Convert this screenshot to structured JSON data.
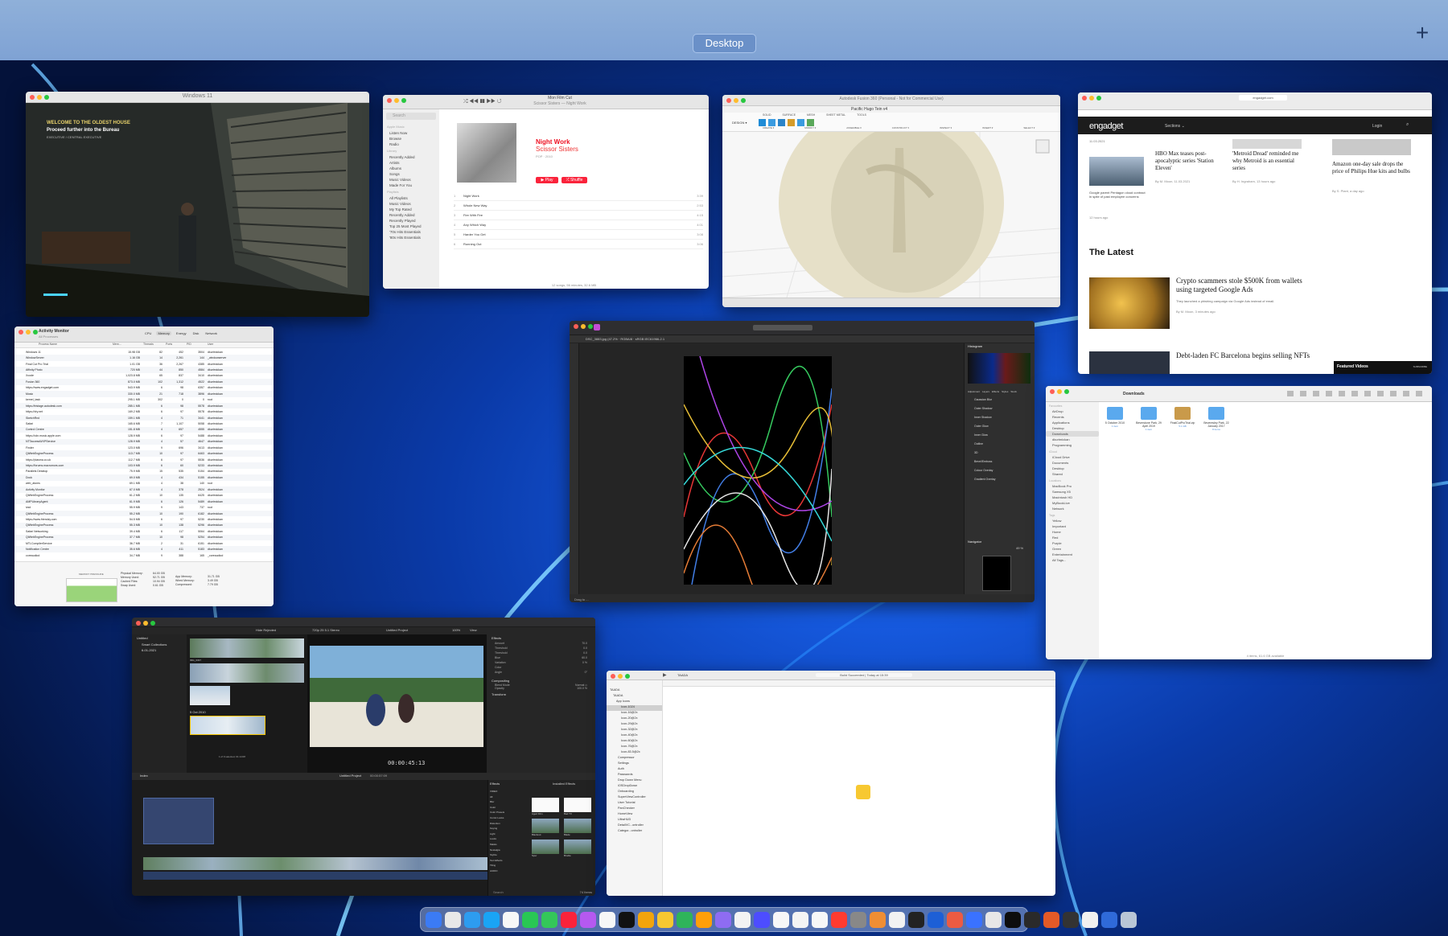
{
  "mission_control": {
    "space_label": "Desktop",
    "add_space_symbol": "+"
  },
  "windows": {
    "game": {
      "title": "Windows 11",
      "hud_line1": "WELCOME TO THE OLDEST HOUSE",
      "hud_line2": "Proceed further into the Bureau",
      "hud_line3": "EXECUTIVE / CENTRAL EXECUTIVE"
    },
    "music": {
      "now_playing_title": "Mon Film Cut",
      "now_playing_sub": "Scissor Sisters — Night Work",
      "search_placeholder": "Search",
      "sidebar_heading_apple": "Apple Music",
      "sidebar_items": [
        "Listen Now",
        "Browse",
        "Radio"
      ],
      "sidebar_heading_library": "Library",
      "library_items": [
        "Recently Added",
        "Artists",
        "Albums",
        "Songs",
        "Music Videos",
        "Made For You"
      ],
      "sidebar_heading_playlists": "Playlists",
      "playlist_items": [
        "All Playlists",
        "Music Videos",
        "My Top Rated",
        "Recently Added",
        "Recently Played",
        "Top 25 Most Played",
        "'70s Hits Essentials",
        "'80s Hits Essentials"
      ],
      "album_title": "Night Work",
      "album_artist": "Scissor Sisters",
      "album_meta": "POP · 2010",
      "play_label": "▶ Play",
      "shuffle_label": "⤮ Shuffle",
      "tracks": [
        {
          "n": "1",
          "name": "Night Work",
          "time": "3:39"
        },
        {
          "n": "2",
          "name": "Whole New Way",
          "time": "2:53"
        },
        {
          "n": "3",
          "name": "Fire With Fire",
          "time": "4:15"
        },
        {
          "n": "4",
          "name": "Any Which Way",
          "time": "4:01"
        },
        {
          "n": "5",
          "name": "Harder You Get",
          "time": "3:08"
        },
        {
          "n": "6",
          "name": "Running Out",
          "time": "3:06"
        }
      ],
      "footer": "12 songs, 56 minutes, 32.6 MB"
    },
    "fusion": {
      "title": "Autodesk Fusion 360 (Personal - Not for Commercial Use)",
      "tab_title": "Pacific Hugo Tein v4",
      "toolbar_tabs": [
        "SOLID",
        "SURFACE",
        "MESH",
        "SHEET METAL",
        "TOOLS"
      ],
      "design_label": "DESIGN ▾",
      "toolbar_groups": [
        "CREATE ▾",
        "MODIFY ▾",
        "ASSEMBLE ▾",
        "CONSTRUCT ▾",
        "INSPECT ▾",
        "INSERT ▾",
        "SELECT ▾"
      ]
    },
    "engadget": {
      "url": "engadget.com",
      "logo": "engadget",
      "nav_sections": "Sections ⌄",
      "nav_login": "Login",
      "date_left": "11.03.2021",
      "left_blurb": "Google parent Pentagon cloud contract in spite of past employee concerns",
      "left_time": "12 hours ago",
      "headline1": "HBO Max teases post-apocalyptic series 'Station Eleven'",
      "byline1": "By M. Moon, 11.03.2021",
      "headline2": "'Metroid Dread' reminded me why Metroid is an essential series",
      "byline2": "By H. Ingraham, 13 hours ago",
      "headline3": "Amazon one-day sale drops the price of Philips Hue kits and bulbs",
      "byline3": "By S. Plant, a day ago",
      "latest_heading": "The Latest",
      "latest1_title": "Crypto scammers stole $500K from wallets using targeted Google Ads",
      "latest1_blurb": "They launched a phishing campaign via Google Ads instead of email.",
      "latest1_byline": "By M. Moon, 3 minutes ago",
      "latest2_title": "Debt-laden FC Barcelona begins selling NFTs",
      "featured_label": "Featured Videos",
      "subscribe_label": "SUBSCRIBE"
    },
    "activity": {
      "title": "Activity Monitor",
      "subtitle": "All Processes",
      "tabs": [
        "CPU",
        "Memory",
        "Energy",
        "Disk",
        "Network"
      ],
      "columns": [
        "Process Name",
        "Mem...",
        "Threads",
        "Ports",
        "PID",
        "User"
      ],
      "rows": [
        [
          "Windows 11",
          "15.98 GB",
          "82",
          "452",
          "3504",
          "dkurtmickan"
        ],
        [
          "WindowServer",
          "1.16 GB",
          "14",
          "2,261",
          "144",
          "_windowserver"
        ],
        [
          "Final Cut Pro Trial",
          "1.01 GB",
          "36",
          "2,267",
          "4385",
          "dkurtmickan"
        ],
        [
          "Affinity Photo",
          "720 MB",
          "44",
          "850",
          "4584",
          "dkurtmickan"
        ],
        [
          "Xcode",
          "1,023.8 MB",
          "65",
          "837",
          "3410",
          "dkurtmickan"
        ],
        [
          "Fusion 360",
          "873.0 MB",
          "102",
          "1,312",
          "4522",
          "dkurtmickan"
        ],
        [
          "https://www.engadget.com",
          "543.9 MB",
          "6",
          "98",
          "6357",
          "dkurtmickan"
        ],
        [
          "Music",
          "330.0 MB",
          "21",
          "718",
          "3896",
          "dkurtmickan"
        ],
        [
          "kernel_task",
          "295.1 MB",
          "302",
          "0",
          "0",
          "root"
        ],
        [
          "https://tristage.autodesk.com",
          "285.1 MB",
          "6",
          "98",
          "5578",
          "dkurtmickan"
        ],
        [
          "https://dry.net",
          "169.2 MB",
          "6",
          "97",
          "5578",
          "dkurtmickan"
        ],
        [
          "SketchRnd",
          "159.1 MB",
          "4",
          "71",
          "3441",
          "dkurtmickan"
        ],
        [
          "Safari",
          "165.6 MB",
          "7",
          "1,107",
          "5058",
          "dkurtmickan"
        ],
        [
          "Control Centre",
          "151.8 MB",
          "4",
          "657",
          "4555",
          "dkurtmickan"
        ],
        [
          "https://cdn.music.apple.com",
          "128.9 MB",
          "6",
          "97",
          "5488",
          "dkurtmickan"
        ],
        [
          "NTTaccessWXPService",
          "128.9 MB",
          "4",
          "57",
          "4647",
          "dkurtmickan"
        ],
        [
          "Finder",
          "123.0 MB",
          "9",
          "696",
          "3413",
          "dkurtmickan"
        ],
        [
          "QtWebEngineProcess",
          "113.7 MB",
          "10",
          "97",
          "6463",
          "dkurtmickan"
        ],
        [
          "https://plasma.co.uk",
          "112.7 MB",
          "6",
          "97",
          "5536",
          "dkurtmickan"
        ],
        [
          "https://forums.macrumors.com",
          "103.9 MB",
          "6",
          "60",
          "5233",
          "dkurtmickan"
        ],
        [
          "Parallels Desktop",
          "75.9 MB",
          "15",
          "535",
          "5154",
          "dkurtmickan"
        ],
        [
          "Dock",
          "69.0 MB",
          "4",
          "434",
          "5155",
          "dkurtmickan"
        ],
        [
          "web_atoms",
          "69.1 MB",
          "4",
          "38",
          "140",
          "root"
        ],
        [
          "Activity Monitor",
          "67.0 MB",
          "4",
          "378",
          "2524",
          "dkurtmickan"
        ],
        [
          "QtWebEngineProcess",
          "61.2 MB",
          "10",
          "135",
          "6425",
          "dkurtmickan"
        ],
        [
          "AMPLibraryAgent",
          "61.9 MB",
          "6",
          "126",
          "5489",
          "dkurtmickan"
        ],
        [
          "ivsd",
          "55.9 MB",
          "9",
          "143",
          "737",
          "root"
        ],
        [
          "QtWebEngineProcess",
          "55.2 MB",
          "10",
          "190",
          "6182",
          "dkurtmickan"
        ],
        [
          "https://www.friendzy.com",
          "54.5 MB",
          "6",
          "97",
          "5230",
          "dkurtmickan"
        ],
        [
          "QtWebEngineProcess",
          "55.3 MB",
          "10",
          "138",
          "5296",
          "dkurtmickan"
        ],
        [
          "Safari Networking",
          "39.4 MB",
          "6",
          "117",
          "5064",
          "dkurtmickan"
        ],
        [
          "QtWebEngineProcess",
          "37.7 MB",
          "10",
          "98",
          "5254",
          "dkurtmickan"
        ],
        [
          "MTLCompilerService",
          "36.7 MB",
          "2",
          "31",
          "6151",
          "dkurtmickan"
        ],
        [
          "Notification Centre",
          "35.6 MB",
          "4",
          "411",
          "5183",
          "dkurtmickan"
        ],
        [
          "coreaudiod",
          "34.7 MB",
          "9",
          "388",
          "165",
          "_coreaudiod"
        ]
      ],
      "pressure_label": "MEMORY PRESSURE",
      "stats_left": [
        [
          "Physical Memory:",
          "64.00 GB"
        ],
        [
          "Memory Used:",
          "52.71 GB"
        ],
        [
          "Cached Files:",
          "10.94 GB"
        ],
        [
          "Swap Used:",
          "0.61 GB"
        ]
      ],
      "stats_right": [
        [
          "App Memory:",
          "31.71 GB"
        ],
        [
          "Wired Memory:",
          "3.49 GB"
        ],
        [
          "Compressed:",
          "7.79 GB"
        ]
      ]
    },
    "affinity": {
      "doc_tab": "DSC_3883.jpg (47.2% · RGBA/8 · sRGB IEC61966-2.1",
      "histogram_label": "Histogram",
      "panels": [
        "Adjustment",
        "Layers",
        "Effects",
        "Styles",
        "Stock"
      ],
      "effects": [
        "Gaussian Blur",
        "Outer Shadow",
        "Inner Shadow",
        "Outer Glow",
        "Inner Glow",
        "Outline",
        "3D",
        "Bevel/Emboss",
        "Colour Overlay",
        "Gradient Overlay"
      ],
      "navigator_label": "Navigator",
      "zoom": "49 %",
      "status": "Drag to ..."
    },
    "finder": {
      "title": "Downloads",
      "sidebar_heading_fav": "Favourites",
      "favourites": [
        "AirDrop",
        "Recents",
        "Applications",
        "Desktop",
        "Downloads",
        "dkurtmickan",
        "Programming"
      ],
      "sidebar_heading_icloud": "iCloud",
      "icloud": [
        "iCloud Drive",
        "Documents",
        "Desktop",
        "Shared"
      ],
      "sidebar_heading_loc": "Locations",
      "locations": [
        "MacBook Pro",
        "Samsung X5",
        "Macintosh HD",
        "MyBookLive",
        "Network"
      ],
      "sidebar_heading_tags": "Tags",
      "tags": [
        "Yellow",
        "Important",
        "Home",
        "Red",
        "Purple",
        "Green",
        "Entertainment",
        "All Tags..."
      ],
      "items": [
        {
          "name": "5 October 2010",
          "meta": "1 item"
        },
        {
          "name": "Beverstone Park, 29 April 2019",
          "meta": "1 item"
        },
        {
          "name": "FinalCutProTrial.zip",
          "meta": "5.1 GB"
        },
        {
          "name": "Beveresley Park, 22 January 2017",
          "meta": "8 items"
        }
      ],
      "status": "4 items, 61.6 GB available"
    },
    "fcp": {
      "library": "Untitled",
      "collections": "Smart Collections",
      "event": "6-01-2021",
      "hide_rejected": "Hide Rejected",
      "format": "720p 25 5.1 Stereo",
      "project": "Untitled Project",
      "zoom": "100%",
      "view": "View",
      "clip1": "IMG_0337",
      "event_label": "5 Oct 2010",
      "clip_count": "1 of 9 selected, 01:14:08",
      "timecode": "00:00:45:13",
      "inspector_title": "Effects",
      "inspector_rows": [
        [
          "Amount",
          "70.0"
        ],
        [
          "Threshold",
          "0.0"
        ],
        [
          "Threshold",
          "0.0"
        ],
        [
          "Blue",
          "60.0"
        ],
        [
          "Variation",
          "0 %"
        ],
        [
          "Color",
          ""
        ],
        [
          "Angle",
          "0°"
        ]
      ],
      "compositing": "Compositing",
      "blend_mode": "Blend Mode",
      "blend_value": "Normal ◇",
      "opacity": "Opacity",
      "opacity_value": "100.0 %",
      "transform": "Transform",
      "index_label": "Index",
      "timeline_project": "Untitled Project",
      "timeline_duration": "00:00:57:09",
      "effects_heading": "Effects",
      "installed_effects": "Installed Effects",
      "effect_categories": [
        "VIDEO",
        "All",
        "Blur",
        "Color",
        "Color Presets",
        "Comic Looks",
        "Distortion",
        "Keying",
        "Light",
        "Looks",
        "Masks",
        "Nostalgia",
        "Stylize",
        "Text Effects",
        "Tiling",
        "AUDIO"
      ],
      "effect_names": [
        "Aged Film",
        "Bad TV",
        "Blackout",
        "Blade",
        "Spur",
        "Brodie"
      ],
      "search_placeholder": "Search",
      "items_count": "74 Items",
      "timeline_clips": [
        "IMG_0330",
        "IMG_0331",
        "IMG_0333"
      ]
    },
    "xcode": {
      "project": "TAADA",
      "status": "Build Succeeded | Today at 15:39",
      "tree": [
        "TAADA",
        "TAADA",
        "App Icons",
        "Icon-1024",
        "Icon-16@2x",
        "Icon-20@2x",
        "Icon-29@2x",
        "Icon-32@2x",
        "Icon-40@2x",
        "Icon-60@2x",
        "Icon-76@2x",
        "Icon-83.5@2x",
        "Compressor",
        "Settings",
        "Auth",
        "Passwords",
        "Drop Down Menu",
        "iOSDropDown",
        "Onboarding",
        "SuperViewController",
        "User Tutorial",
        "PanChecker",
        "HomeView",
        "UltraHUD",
        "DetailVC...ontroller",
        "Categor...ontroller"
      ]
    }
  },
  "dock_colors": [
    "#3b7bf5",
    "#e8e8e8",
    "#2d9cf0",
    "#1aa4f5",
    "#f7f7f7",
    "#29c754",
    "#34c759",
    "#fa233b",
    "#b559f0",
    "#f7f7f7",
    "#111111",
    "#f2a40c",
    "#f7c831",
    "#2fb45a",
    "#ff9f0a",
    "#8e6cf2",
    "#f3f3f3",
    "#4d4dff",
    "#f7f7f7",
    "#f4f4f4",
    "#f7f7f7",
    "#ff3b30",
    "#888888",
    "#ef8e34",
    "#f2f2f2",
    "#222222",
    "#1d5fd6",
    "#ec5b43",
    "#3a72ff",
    "#e7e7e7",
    "#0d0d0d",
    "#2a2a2a",
    "#e35a27",
    "#333333",
    "#f0f0f0",
    "#2f6ad9",
    "#b9c6d6"
  ]
}
